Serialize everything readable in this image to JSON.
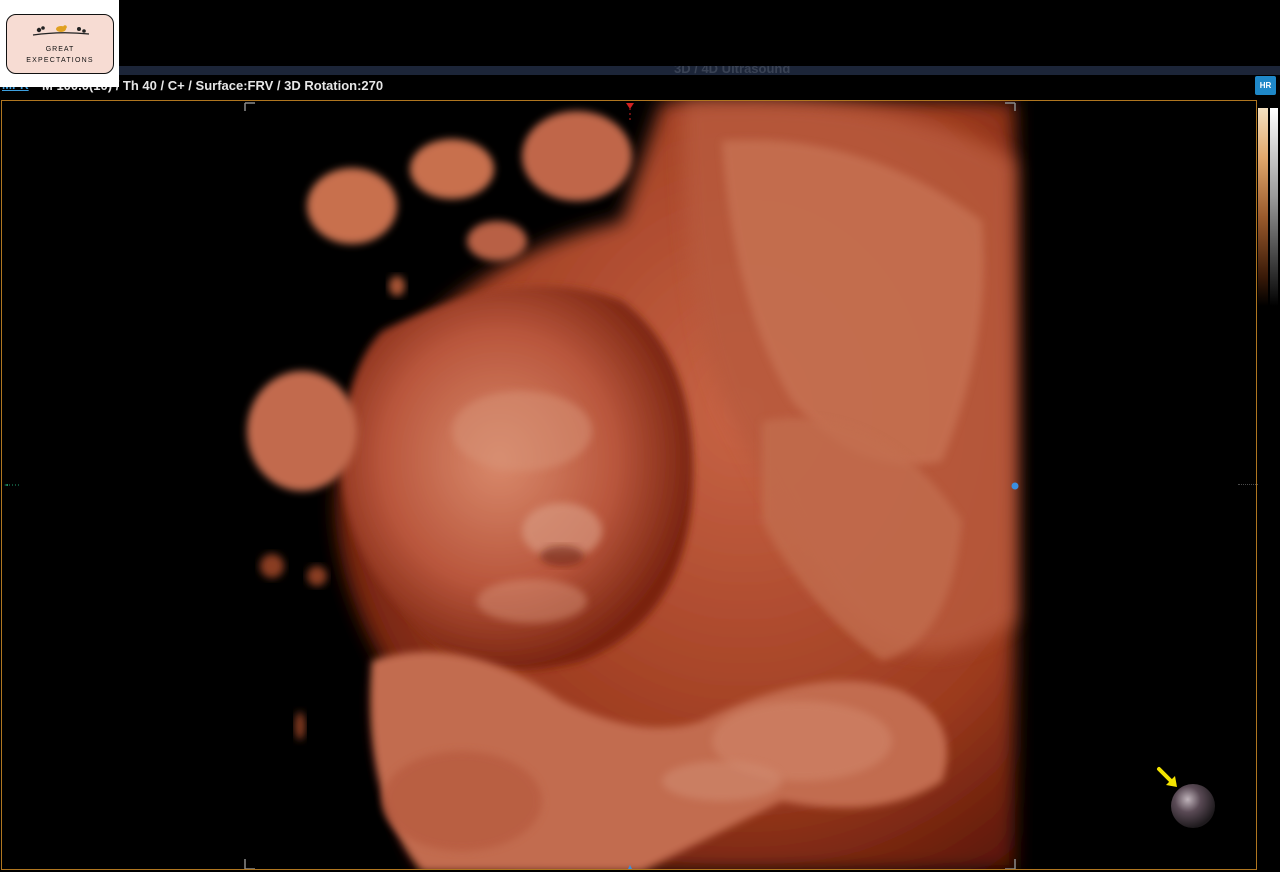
{
  "logo": {
    "line1": "GREAT",
    "line2": "EXPECTATIONS"
  },
  "header": {
    "faded_title": "3D / 4D Ultrasound",
    "mode_tag": "MPR",
    "info": "M 100.0(10) / Th 40 / C+ / Surface:FRV / 3D Rotation:270",
    "hr_button": "HR"
  },
  "icons": {
    "hr_button": "hr-zoom-icon",
    "orientation": "orientation-sphere-icon",
    "arrow": "yellow-arrow-icon",
    "logo_branch": "branch-bird-icon"
  },
  "colors": {
    "frame_border": "#b07620",
    "accent_blue": "#1f88c8",
    "render_skin": "#c8654a",
    "arrow_yellow": "#f4e400",
    "marker_red": "#d02020",
    "marker_blue": "#3a8ee0"
  },
  "colorbar": {
    "top": "#f4e0c0",
    "mid": "#9a5a2c",
    "bottom": "#000000"
  }
}
